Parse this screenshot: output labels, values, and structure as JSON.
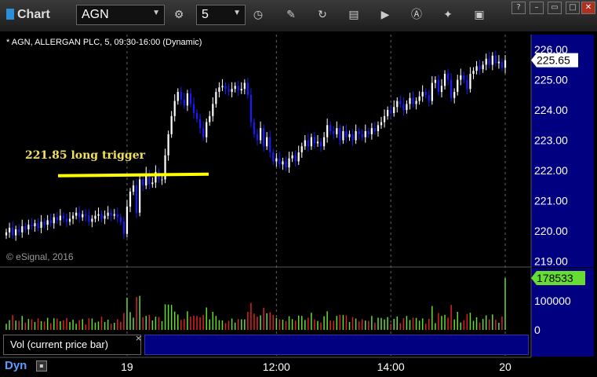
{
  "toolbar": {
    "title": "Chart",
    "symbol": "AGN",
    "interval": "5"
  },
  "chart_header": "* AGN, ALLERGAN PLC, 5, 09:30-16:00 (Dynamic)",
  "copyright": "© eSignal, 2016",
  "annotation": {
    "text": "221.85 long trigger",
    "level": 221.85,
    "color": "#ffff00"
  },
  "last_price_label": "225.65",
  "last_volume_label": "178533",
  "volume_study_label": "Vol (current price bar)",
  "dyn_label": "Dyn",
  "colors": {
    "up": "#ffffff",
    "down": "#1a1aff",
    "vol_up": "#66dd33",
    "vol_down": "#dd2222",
    "price_panel": "#000080"
  },
  "chart_data": {
    "type": "candlestick",
    "price_axis": {
      "ylim": [
        218.8,
        226.5
      ],
      "ticks": [
        219.0,
        220.0,
        221.0,
        222.0,
        223.0,
        224.0,
        225.0,
        226.0
      ],
      "tick_labels": [
        "219.00",
        "220.00",
        "221.00",
        "222.00",
        "223.00",
        "224.00",
        "225.00",
        "226.00"
      ]
    },
    "volume_axis": {
      "ylim": [
        0,
        200000
      ],
      "ticks": [
        0,
        100000
      ],
      "tick_labels": [
        "0",
        "100000"
      ]
    },
    "x_tick_labels": [
      {
        "label": "19",
        "bar": 38
      },
      {
        "label": "12:00",
        "bar": 85
      },
      {
        "label": "14:00",
        "bar": 121
      },
      {
        "label": "20",
        "bar": 157
      }
    ],
    "last_close": 225.65,
    "last_volume": 178533,
    "closes": [
      219.95,
      220.1,
      219.85,
      220.05,
      219.95,
      220.15,
      220.05,
      220.2,
      220.15,
      220.25,
      220.1,
      220.3,
      220.2,
      220.35,
      220.25,
      220.45,
      220.35,
      220.5,
      220.4,
      220.3,
      220.4,
      220.5,
      220.6,
      220.45,
      220.55,
      220.5,
      220.3,
      220.4,
      220.5,
      220.55,
      220.4,
      220.5,
      220.6,
      220.5,
      220.55,
      220.45,
      220.3,
      219.9,
      220.8,
      221.3,
      221.5,
      220.6,
      221.7,
      221.5,
      221.9,
      221.55,
      221.6,
      221.95,
      221.7,
      221.7,
      222.5,
      223.2,
      223.8,
      224.3,
      224.6,
      224.35,
      224.15,
      224.55,
      224.2,
      223.9,
      223.7,
      223.4,
      223.1,
      223.6,
      223.8,
      224.2,
      224.6,
      224.75,
      224.8,
      224.7,
      224.6,
      224.7,
      224.8,
      224.65,
      224.7,
      224.9,
      224.5,
      223.6,
      223.2,
      223.0,
      223.4,
      222.8,
      223.1,
      222.6,
      222.3,
      222.4,
      222.2,
      222.3,
      222.1,
      222.4,
      222.5,
      222.3,
      222.6,
      222.8,
      223.0,
      222.8,
      223.1,
      222.9,
      222.95,
      222.8,
      223.1,
      223.5,
      223.3,
      223.2,
      223.4,
      223.0,
      223.3,
      223.1,
      223.2,
      223.0,
      223.3,
      223.2,
      223.1,
      223.3,
      223.2,
      223.4,
      223.3,
      223.5,
      223.6,
      223.8,
      224.0,
      223.9,
      224.1,
      224.3,
      224.2,
      224.0,
      224.2,
      224.4,
      224.2,
      224.3,
      224.45,
      224.6,
      224.5,
      224.3,
      224.9,
      225.0,
      224.6,
      224.8,
      225.2,
      225.0,
      224.4,
      224.6,
      225.0,
      225.15,
      225.0,
      224.7,
      225.2,
      225.3,
      225.45,
      225.35,
      225.5,
      225.7,
      225.5,
      225.8,
      225.55,
      225.6,
      225.4,
      225.65
    ]
  }
}
